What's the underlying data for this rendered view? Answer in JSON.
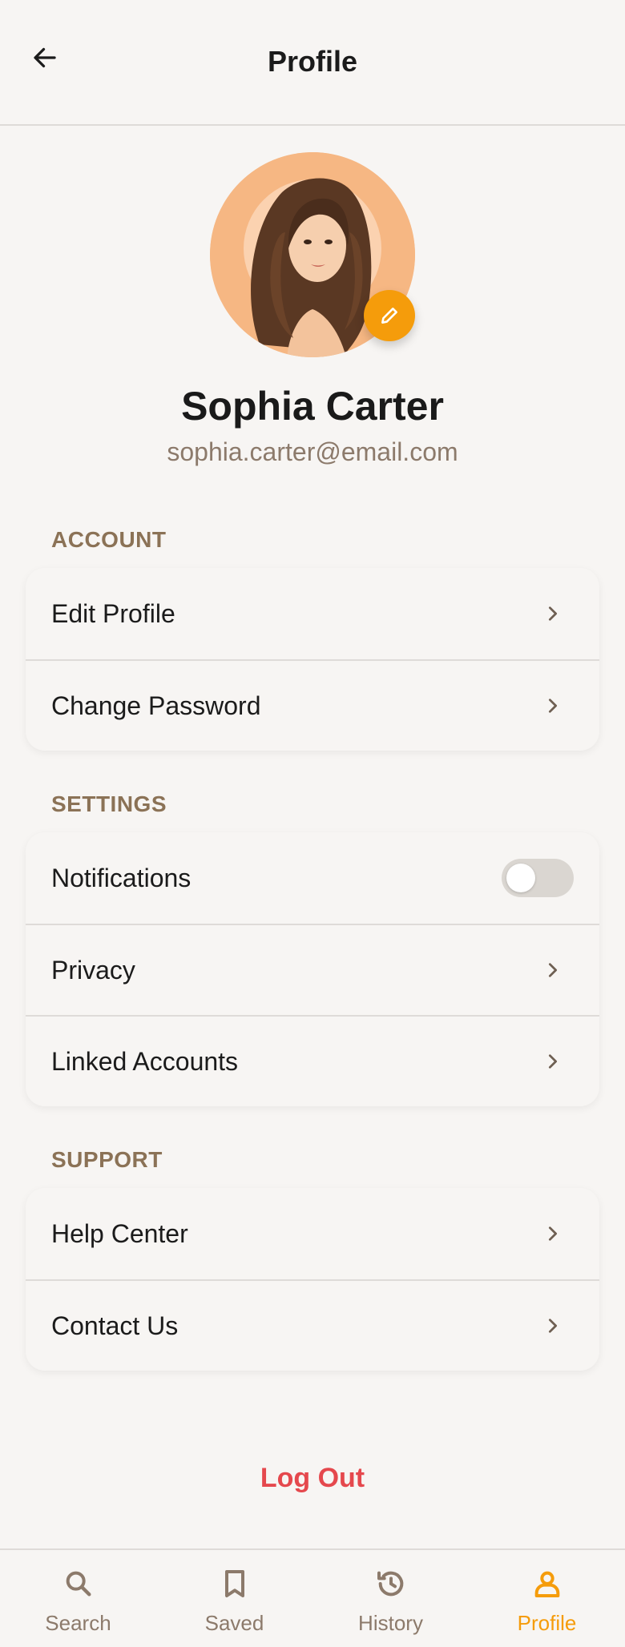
{
  "header": {
    "title": "Profile",
    "back_icon": "arrow-left-icon"
  },
  "profile": {
    "name": "Sophia Carter",
    "email": "sophia.carter@email.com",
    "edit_icon": "pencil-icon"
  },
  "sections": {
    "account": {
      "label": "ACCOUNT",
      "items": [
        {
          "label": "Edit Profile"
        },
        {
          "label": "Change Password"
        }
      ]
    },
    "settings": {
      "label": "SETTINGS",
      "items": [
        {
          "label": "Notifications",
          "toggle_on": false
        },
        {
          "label": "Privacy"
        },
        {
          "label": "Linked Accounts"
        }
      ]
    },
    "support": {
      "label": "SUPPORT",
      "items": [
        {
          "label": "Help Center"
        },
        {
          "label": "Contact Us"
        }
      ]
    }
  },
  "logout_label": "Log Out",
  "nav": {
    "items": [
      {
        "label": "Search",
        "icon": "search-icon"
      },
      {
        "label": "Saved",
        "icon": "bookmark-icon"
      },
      {
        "label": "History",
        "icon": "history-icon"
      },
      {
        "label": "Profile",
        "icon": "person-icon",
        "active": true
      }
    ]
  },
  "colors": {
    "accent": "#f59c0b",
    "background": "#f7f5f3",
    "section_label": "#8b7256",
    "logout": "#e5484d",
    "muted": "#8c7a6b"
  }
}
